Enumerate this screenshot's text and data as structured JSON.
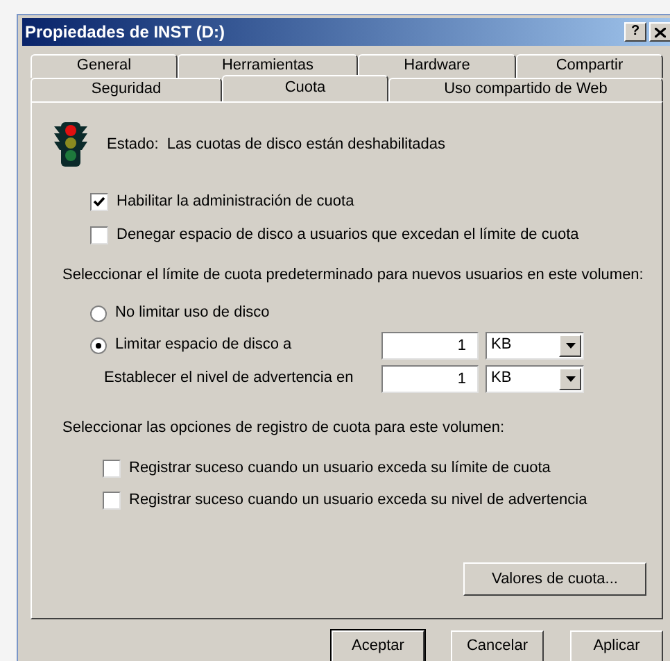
{
  "window": {
    "title": "Propiedades de INST (D:)",
    "help_button": "?"
  },
  "tabs": [
    [
      {
        "label": "General",
        "selected": false
      },
      {
        "label": "Herramientas",
        "selected": false
      },
      {
        "label": "Hardware",
        "selected": false
      },
      {
        "label": "Compartir",
        "selected": false
      }
    ],
    [
      {
        "label": "Seguridad",
        "selected": false
      },
      {
        "label": "Cuota",
        "selected": true
      },
      {
        "label": "Uso compartido de Web",
        "selected": false
      }
    ]
  ],
  "status": "Estado:  Las cuotas de disco están deshabilitadas",
  "options": [
    {
      "label": "Habilitar la administración de cuota",
      "checked": true
    },
    {
      "label": "Denegar espacio de disco a usuarios que excedan el límite de cuota",
      "checked": false
    }
  ],
  "limit_section": {
    "heading": "Seleccionar el límite de cuota predeterminado para nuevos usuarios en este volumen:",
    "radios": [
      {
        "label": "No limitar uso de disco",
        "selected": false
      },
      {
        "label": "Limitar espacio de disco a",
        "selected": true
      }
    ],
    "limit": {
      "value": "1",
      "unit": "KB"
    },
    "warning": {
      "label": "Establecer el nivel de advertencia en",
      "value": "1",
      "unit": "KB"
    }
  },
  "log_section": {
    "heading": "Seleccionar las opciones de registro de cuota para este volumen:",
    "options": [
      {
        "label": "Registrar suceso cuando un usuario exceda su límite de cuota",
        "checked": false
      },
      {
        "label": "Registrar suceso cuando un usuario exceda su nivel de advertencia",
        "checked": false
      }
    ]
  },
  "values_button": "Valores de cuota...",
  "buttons": [
    "Aceptar",
    "Cancelar",
    "Aplicar"
  ]
}
